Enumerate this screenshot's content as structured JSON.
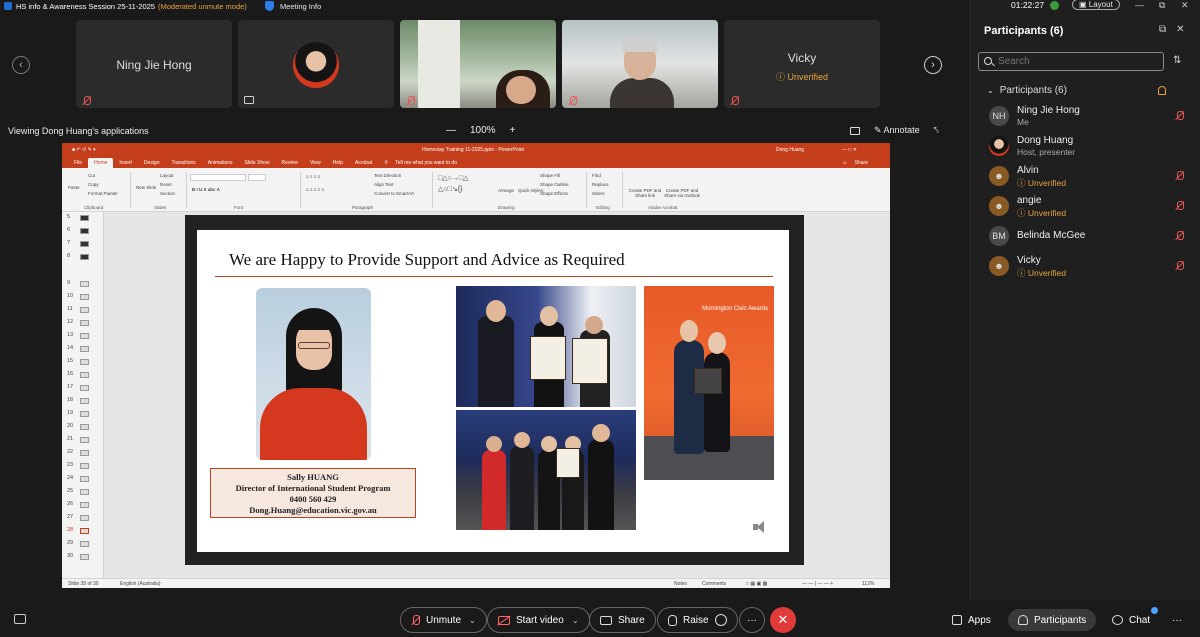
{
  "titlebar": {
    "title": "HS info & Awareness Session 25-11-2025",
    "mode": "(Moderated unmute mode)",
    "meeting_info": "Meeting Info"
  },
  "video_strip": {
    "tiles": [
      {
        "name": "Ning Jie Hong"
      },
      {
        "name": ""
      },
      {
        "name": ""
      },
      {
        "name": ""
      },
      {
        "name": "Vicky",
        "status": "Unverified"
      }
    ]
  },
  "viewing_label": "Viewing Dong Huang's applications",
  "zoom": {
    "minus": "—",
    "value": "100%",
    "plus": "+"
  },
  "annotate_label": "Annotate",
  "powerpoint": {
    "doc_title": "Homestay Training 11-2025.pptx  -  PowerPoint",
    "user": "Dong Huang",
    "tabs": [
      "File",
      "Home",
      "Insert",
      "Design",
      "Transitions",
      "Animations",
      "Slide Show",
      "Review",
      "View",
      "Help",
      "Acrobat",
      "Tell me what you want to do"
    ],
    "share": "Share",
    "ribbon_groups": [
      "Clipboard",
      "Slides",
      "Font",
      "Paragraph",
      "Drawing",
      "Editing",
      "Adobe Acrobat"
    ],
    "ribbon_items": {
      "paste": "Paste",
      "cut": "Cut",
      "copy": "Copy",
      "format_painter": "Format Painter",
      "new_slide": "New Slide",
      "layout": "Layout",
      "reset": "Reset",
      "section": "Section",
      "text_direction": "Text Direction",
      "align_text": "Align Text",
      "convert_smartart": "Convert to SmartArt",
      "arrange": "Arrange",
      "quick_styles": "Quick Styles",
      "shape_fill": "Shape Fill",
      "shape_outline": "Shape Outline",
      "shape_effects": "Shape Effects",
      "find": "Find",
      "replace": "Replace",
      "select": "Select",
      "create_pdf_link": "Create PDF and Share link",
      "create_pdf_outlook": "Create PDF and Share via Outlook"
    },
    "thumb_numbers": [
      "5",
      "6",
      "7",
      "8",
      "9",
      "10",
      "11",
      "12",
      "13",
      "14",
      "15",
      "16",
      "17",
      "18",
      "19",
      "20",
      "21",
      "22",
      "23",
      "24",
      "25",
      "26",
      "27",
      "28",
      "29",
      "30"
    ],
    "current_slide": "28",
    "slide": {
      "heading": "We are Happy to Provide Support and Advice as Required",
      "card_lines": [
        "Sally HUANG",
        "Director of International Student Program",
        "0400 560 429",
        "Dong.Huang@education.vic.gov.au"
      ],
      "civic_text": "Mornington Civic Awards"
    },
    "status": {
      "slide_of": "Slide 28 of 30",
      "language": "English (Australia)",
      "notes": "Notes",
      "comments": "Comments",
      "zoom": "112%"
    }
  },
  "panel": {
    "clock": "01:22:27",
    "layout": "Layout",
    "title": "Participants (6)",
    "search_placeholder": "Search",
    "group": "Participants (6)",
    "participants": [
      {
        "initials": "NH",
        "name": "Ning Jie Hong",
        "sub": "Me"
      },
      {
        "initials": "",
        "name": "Dong Huang",
        "sub": "Host, presenter"
      },
      {
        "initials": "",
        "name": "Alvin",
        "sub": "Unverified"
      },
      {
        "initials": "",
        "name": "angie",
        "sub": "Unverified"
      },
      {
        "initials": "BM",
        "name": "Belinda McGee",
        "sub": ""
      },
      {
        "initials": "",
        "name": "Vicky",
        "sub": "Unverified"
      }
    ]
  },
  "controls": {
    "unmute": "Unmute",
    "start_video": "Start video",
    "share": "Share",
    "raise": "Raise",
    "more": "···",
    "leave": "✕",
    "apps": "Apps",
    "participants": "Participants",
    "chat": "Chat",
    "overflow": "···"
  },
  "colors": {
    "accent_ppt": "#c43e1c",
    "leave": "#e03a3a",
    "warning": "#e8a33d",
    "mute": "#ee5555"
  }
}
